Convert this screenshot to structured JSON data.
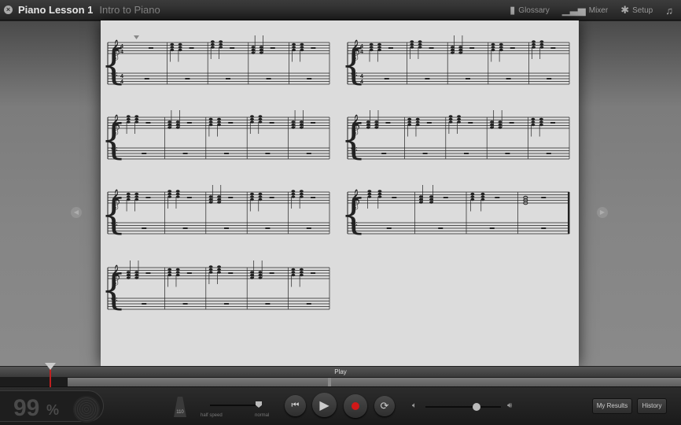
{
  "title": "Piano Lesson 1",
  "subtitle": "Intro to Piano",
  "toolbar": {
    "glossary": "Glossary",
    "mixer": "Mixer",
    "setup": "Setup"
  },
  "transport": {
    "play_label": "Play",
    "score_value": "99",
    "score_unit": "%",
    "tempo": "110",
    "speed_min": "half speed",
    "speed_max": "normal",
    "speed_level": 1.0,
    "volume_level": 0.65
  },
  "buttons": {
    "my_results": "My Results",
    "history": "History"
  },
  "colors": {
    "record": "#d01818",
    "playhead": "#c02020"
  }
}
